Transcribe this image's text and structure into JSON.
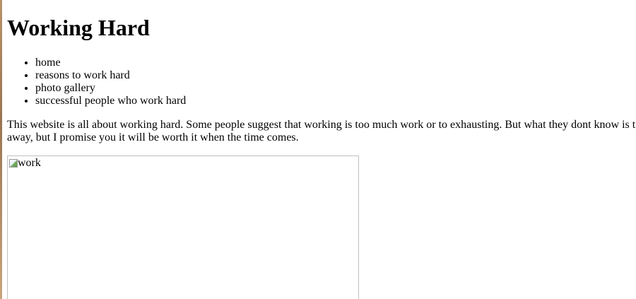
{
  "page": {
    "title": "Working Hard"
  },
  "nav": {
    "items": [
      {
        "label": "home"
      },
      {
        "label": "reasons to work hard"
      },
      {
        "label": "photo gallery"
      },
      {
        "label": "successful people who work hard"
      }
    ]
  },
  "intro": {
    "line1": "This website is all about working hard. Some people suggest that working is too much work or to exhausting. But what they dont know is t",
    "line2": "away, but I promise you it will be worth it when the time comes."
  },
  "image": {
    "alt": "work",
    "icon": "broken-image-icon"
  }
}
